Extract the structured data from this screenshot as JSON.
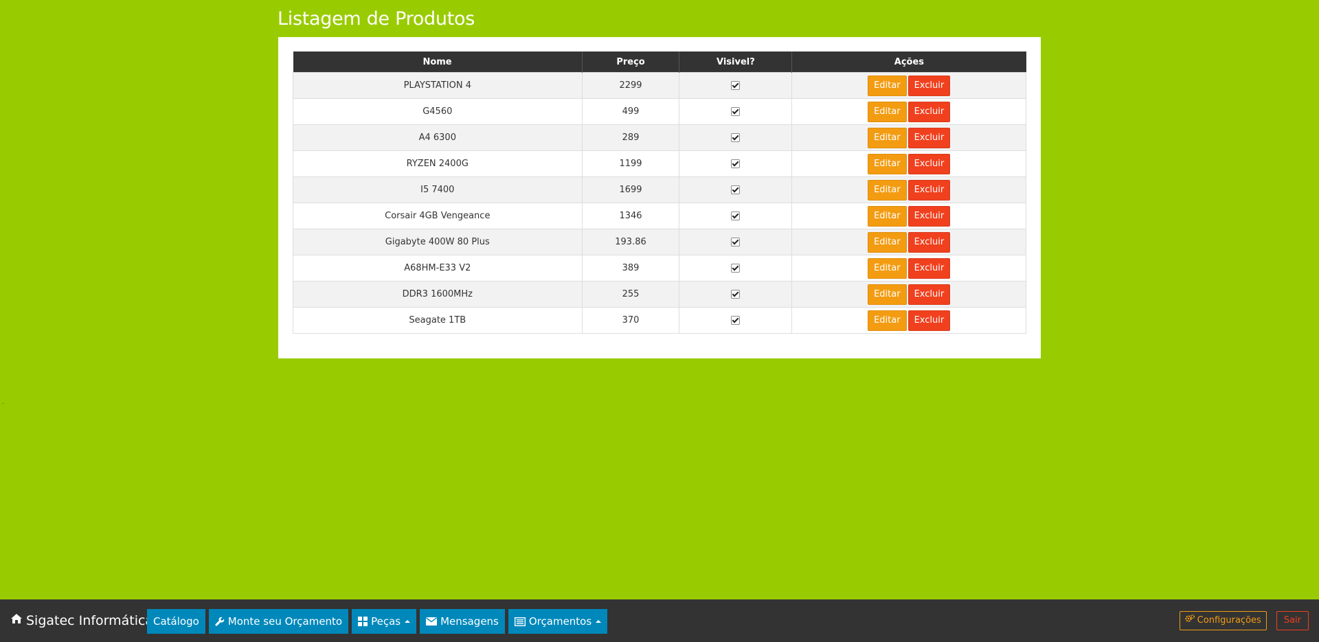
{
  "page": {
    "title": "Listagem de Produtos"
  },
  "table": {
    "headers": [
      "Nome",
      "Preço",
      "Visivel?",
      "Ações"
    ],
    "rows": [
      {
        "nome": "PLAYSTATION 4",
        "preco": "2299",
        "visivel": true
      },
      {
        "nome": "G4560",
        "preco": "499",
        "visivel": true
      },
      {
        "nome": "A4 6300",
        "preco": "289",
        "visivel": true
      },
      {
        "nome": "RYZEN 2400G",
        "preco": "1199",
        "visivel": true
      },
      {
        "nome": "I5 7400",
        "preco": "1699",
        "visivel": true
      },
      {
        "nome": "Corsair 4GB Vengeance",
        "preco": "1346",
        "visivel": true
      },
      {
        "nome": "Gigabyte 400W 80 Plus",
        "preco": "193.86",
        "visivel": true
      },
      {
        "nome": "A68HM-E33 V2",
        "preco": "389",
        "visivel": true
      },
      {
        "nome": "DDR3 1600MHz",
        "preco": "255",
        "visivel": true
      },
      {
        "nome": "Seagate 1TB",
        "preco": "370",
        "visivel": true
      }
    ],
    "edit_label": "Editar",
    "delete_label": "Excluir"
  },
  "navbar": {
    "brand": "Sigatec Informática",
    "brand_icon": "home-icon",
    "items": [
      {
        "label": "Catálogo",
        "icon": null,
        "dropdown": false
      },
      {
        "label": "Monte seu Orçamento",
        "icon": "wrench-icon",
        "dropdown": false
      },
      {
        "label": "Peças",
        "icon": "grid-icon",
        "dropdown": true
      },
      {
        "label": "Mensagens",
        "icon": "envelope-icon",
        "dropdown": false
      },
      {
        "label": "Orçamentos",
        "icon": "list-icon",
        "dropdown": true
      }
    ],
    "settings_label": "Configurações",
    "settings_icon": "gears-icon",
    "logout_label": "Sair"
  },
  "colors": {
    "background": "#99cc00",
    "navbar": "#333333",
    "nav_button": "#0088bb",
    "edit_button": "#f39c12",
    "delete_button": "#f0401e",
    "table_header": "#333333"
  }
}
